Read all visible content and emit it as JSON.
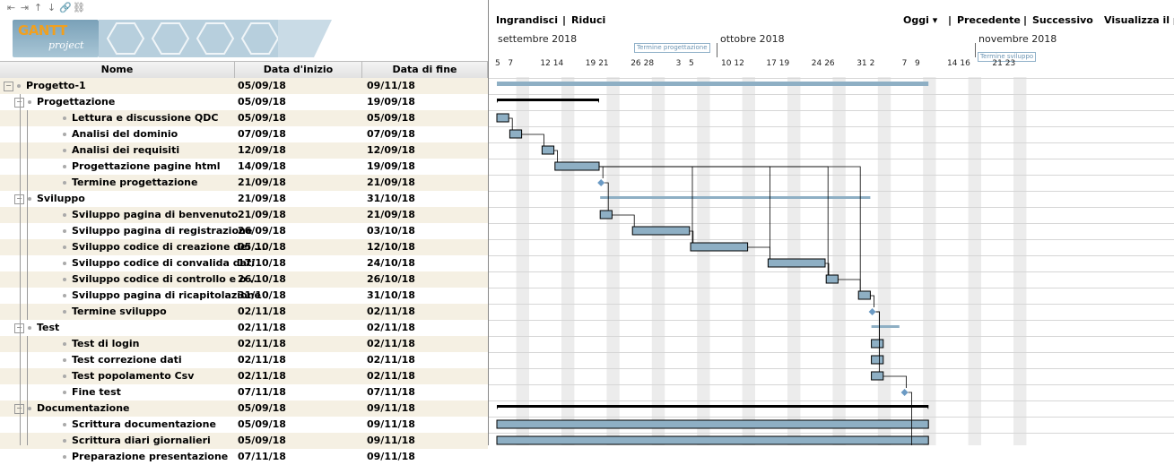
{
  "toolbar_icons": [
    "outdent-icon",
    "indent-icon",
    "move-up-icon",
    "move-down-icon",
    "link-icon",
    "unlink-icon"
  ],
  "toolbar_glyphs": [
    "⇤",
    "⇥",
    "↑",
    "↓",
    "🔗",
    "⛓"
  ],
  "logo": {
    "main": "GANTT",
    "sub": "project"
  },
  "columns": {
    "name": "Nome",
    "start": "Data d'inizio",
    "end": "Data di fine"
  },
  "gantt_toolbar": {
    "zoom_in": "Ingrandisci",
    "sep1": "|",
    "zoom_out": "Riduci",
    "today": "Oggi ▾",
    "sep2": "|",
    "previous": "Precedente",
    "sep3": "|",
    "next": "Successivo",
    "critical_path": "Visualizza il percorso"
  },
  "timeline": {
    "months": [
      "settembre 2018",
      "ottobre 2018",
      "novembre 2018"
    ],
    "milestones": [
      "Termine progettazione",
      "Termine sviluppo"
    ],
    "day_labels": [
      "5",
      "7",
      "12",
      "14",
      "19",
      "21",
      "26",
      "28",
      "3",
      "5",
      "10",
      "12",
      "17",
      "19",
      "24",
      "26",
      "31",
      "2",
      "7",
      "9",
      "14",
      "16",
      "21",
      "23"
    ]
  },
  "colors": {
    "bar": "#8eafc4",
    "summary": "#000000",
    "row_alt": "#f5f0e3",
    "milestone": "#6b9ac4"
  },
  "tasks": [
    {
      "name": "Progetto-1",
      "start": "05/09/18",
      "end": "09/11/18",
      "level": 0,
      "type": "summary"
    },
    {
      "name": "Progettazione",
      "start": "05/09/18",
      "end": "19/09/18",
      "level": 1,
      "type": "summary"
    },
    {
      "name": "Lettura e discussione QDC",
      "start": "05/09/18",
      "end": "05/09/18",
      "level": 2,
      "type": "task"
    },
    {
      "name": "Analisi del dominio",
      "start": "07/09/18",
      "end": "07/09/18",
      "level": 2,
      "type": "task"
    },
    {
      "name": "Analisi dei requisiti",
      "start": "12/09/18",
      "end": "12/09/18",
      "level": 2,
      "type": "task"
    },
    {
      "name": "Progettazione pagine html",
      "start": "14/09/18",
      "end": "19/09/18",
      "level": 2,
      "type": "task"
    },
    {
      "name": "Termine progettazione",
      "start": "21/09/18",
      "end": "21/09/18",
      "level": 2,
      "type": "milestone"
    },
    {
      "name": "Sviluppo",
      "start": "21/09/18",
      "end": "31/10/18",
      "level": 1,
      "type": "summary"
    },
    {
      "name": "Sviluppo pagina di benvenuto",
      "start": "21/09/18",
      "end": "21/09/18",
      "level": 2,
      "type": "task"
    },
    {
      "name": "Sviluppo pagina di registrazione",
      "start": "26/09/18",
      "end": "03/10/18",
      "level": 2,
      "type": "task"
    },
    {
      "name": "Sviluppo codice di creazione dei ...",
      "start": "05/10/18",
      "end": "12/10/18",
      "level": 2,
      "type": "task"
    },
    {
      "name": "Sviluppo codice di convalida dati",
      "start": "17/10/18",
      "end": "24/10/18",
      "level": 2,
      "type": "task"
    },
    {
      "name": "Sviluppo codice di controllo e o ...",
      "start": "26/10/18",
      "end": "26/10/18",
      "level": 2,
      "type": "task"
    },
    {
      "name": "Sviluppo pagina di ricapitolazione",
      "start": "31/10/18",
      "end": "31/10/18",
      "level": 2,
      "type": "task"
    },
    {
      "name": "Termine sviluppo",
      "start": "02/11/18",
      "end": "02/11/18",
      "level": 2,
      "type": "milestone"
    },
    {
      "name": "Test",
      "start": "02/11/18",
      "end": "02/11/18",
      "level": 1,
      "type": "summary"
    },
    {
      "name": "Test di login",
      "start": "02/11/18",
      "end": "02/11/18",
      "level": 2,
      "type": "task"
    },
    {
      "name": "Test correzione dati",
      "start": "02/11/18",
      "end": "02/11/18",
      "level": 2,
      "type": "task"
    },
    {
      "name": "Test popolamento Csv",
      "start": "02/11/18",
      "end": "02/11/18",
      "level": 2,
      "type": "task"
    },
    {
      "name": "Fine test",
      "start": "07/11/18",
      "end": "07/11/18",
      "level": 2,
      "type": "milestone"
    },
    {
      "name": "Documentazione",
      "start": "05/09/18",
      "end": "09/11/18",
      "level": 1,
      "type": "summary"
    },
    {
      "name": "Scrittura documentazione",
      "start": "05/09/18",
      "end": "09/11/18",
      "level": 2,
      "type": "task"
    },
    {
      "name": "Scrittura diari giornalieri",
      "start": "05/09/18",
      "end": "09/11/18",
      "level": 2,
      "type": "task"
    },
    {
      "name": "Preparazione presentazione",
      "start": "07/11/18",
      "end": "09/11/18",
      "level": 2,
      "type": "task"
    }
  ]
}
